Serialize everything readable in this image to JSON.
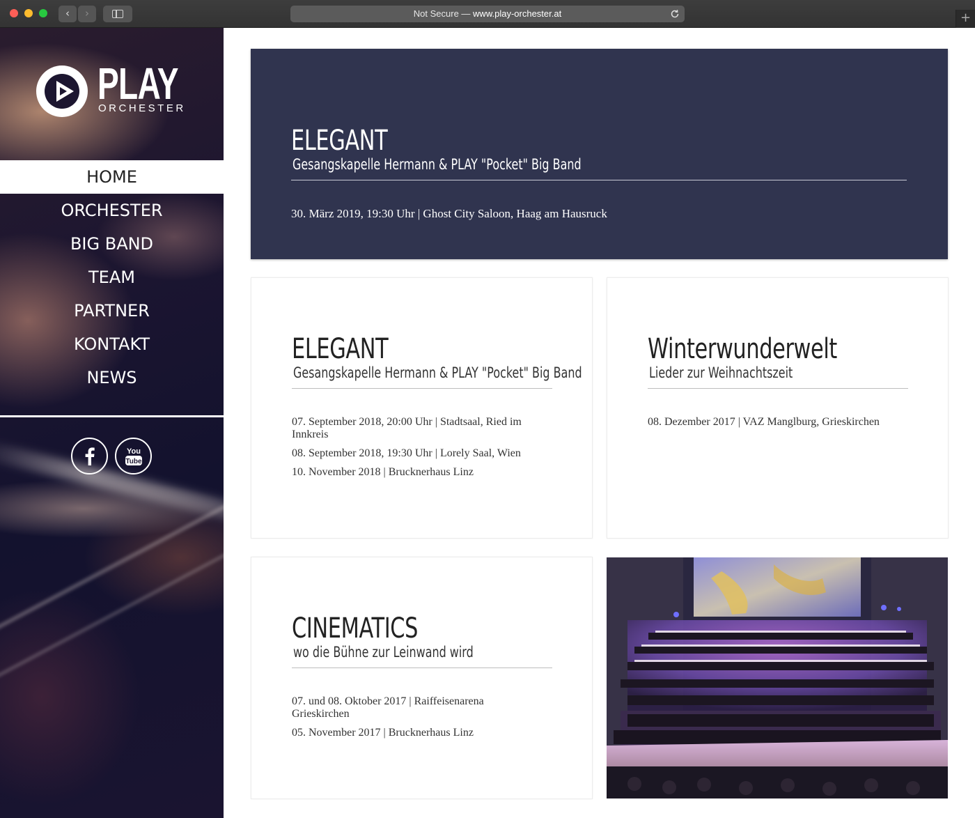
{
  "browser": {
    "address_prefix": "Not Secure — ",
    "address_domain": "www.play-orchester.at",
    "back_glyph": "‹",
    "forward_glyph": "›",
    "newtab_glyph": "+",
    "icons": [
      "back-icon",
      "forward-icon",
      "sidebar-toggle-icon",
      "reload-icon",
      "new-tab-icon"
    ]
  },
  "sidebar": {
    "logo": {
      "word": "PLAY",
      "sub": "ORCHESTER"
    },
    "menu": [
      {
        "label": "HOME",
        "active": true
      },
      {
        "label": "ORCHESTER",
        "active": false
      },
      {
        "label": "BIG BAND",
        "active": false
      },
      {
        "label": "TEAM",
        "active": false
      },
      {
        "label": "PARTNER",
        "active": false
      },
      {
        "label": "KONTAKT",
        "active": false
      },
      {
        "label": "NEWS",
        "active": false
      }
    ],
    "socials": [
      "facebook-icon",
      "youtube-icon"
    ],
    "youtube_label": {
      "line1": "You",
      "line2": "Tube"
    }
  },
  "events": {
    "featured": {
      "title": "ELEGANT",
      "subtitle": "Gesangskapelle Hermann & PLAY \"Pocket\" Big Band",
      "dates": [
        "30. März 2019, 19:30 Uhr | Ghost City Saloon, Haag am Hausruck"
      ]
    },
    "cards": [
      {
        "title": "ELEGANT",
        "subtitle": "Gesangskapelle Hermann & PLAY \"Pocket\" Big Band",
        "dates": [
          "07. September 2018, 20:00 Uhr | Stadtsaal, Ried im Innkreis",
          "08. September 2018, 19:30 Uhr | Lorely Saal, Wien",
          "10. November 2018 | Brucknerhaus Linz"
        ]
      },
      {
        "title": "Winterwunderwelt",
        "subtitle": "Lieder zur Weihnachtszeit",
        "dates": [
          "08. Dezember 2017 | VAZ Manglburg, Grieskirchen"
        ]
      },
      {
        "title": "CINEMATICS",
        "subtitle": "wo die Bühne zur Leinwand wird",
        "dates": [
          "07. und 08. Oktober 2017 | Raiffeisenarena Grieskirchen",
          "05. November 2017 | Brucknerhaus Linz"
        ]
      }
    ]
  },
  "colors": {
    "featured_bg": "#30344f",
    "sidebar_dark": "#13122e",
    "text": "#333333"
  }
}
